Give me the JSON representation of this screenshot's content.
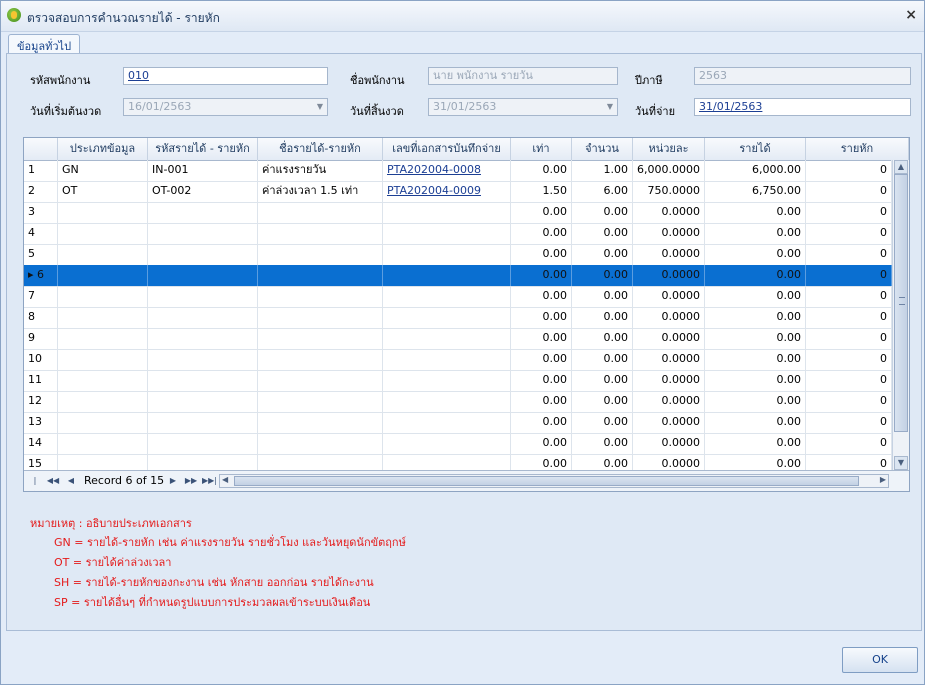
{
  "window": {
    "title": "ตรวจสอบการคำนวณรายได้ - รายหัก",
    "close_glyph": "×"
  },
  "tabs": [
    {
      "label": "ข้อมูลทั่วไป",
      "active": true
    }
  ],
  "form": {
    "employee_code_label": "รหัสพนักงาน",
    "employee_code": "010",
    "employee_name_label": "ชื่อพนักงาน",
    "employee_name": "นาย พนักงาน รายวัน",
    "tax_year_label": "ปีภาษี",
    "tax_year": "2563",
    "period_start_label": "วันที่เริ่มต้นงวด",
    "period_start": "16/01/2563",
    "period_end_label": "วันที่สิ้นงวด",
    "period_end": "31/01/2563",
    "pay_date_label": "วันที่จ่าย",
    "pay_date": "31/01/2563"
  },
  "grid": {
    "columns": [
      "",
      "ประเภทข้อมูล",
      "รหัสรายได้ - รายหัก",
      "ชื่อรายได้-รายหัก",
      "เลขที่เอกสารบันทึกจ่าย",
      "เท่า",
      "จำนวน",
      "หน่วยละ",
      "รายได้",
      "รายหัก"
    ],
    "rows": [
      {
        "no": "1",
        "type": "GN",
        "code": "IN-001",
        "name": "ค่าแรงรายวัน",
        "doc": "PTA202004-0008",
        "times": "0.00",
        "qty": "1.00",
        "unit": "6,000.0000",
        "income": "6,000.00",
        "deduct": "0"
      },
      {
        "no": "2",
        "type": "OT",
        "code": "OT-002",
        "name": "ค่าล่วงเวลา 1.5 เท่า",
        "doc": "PTA202004-0009",
        "times": "1.50",
        "qty": "6.00",
        "unit": "750.0000",
        "income": "6,750.00",
        "deduct": "0"
      },
      {
        "no": "3",
        "type": "",
        "code": "",
        "name": "",
        "doc": "",
        "times": "0.00",
        "qty": "0.00",
        "unit": "0.0000",
        "income": "0.00",
        "deduct": "0"
      },
      {
        "no": "4",
        "type": "",
        "code": "",
        "name": "",
        "doc": "",
        "times": "0.00",
        "qty": "0.00",
        "unit": "0.0000",
        "income": "0.00",
        "deduct": "0"
      },
      {
        "no": "5",
        "type": "",
        "code": "",
        "name": "",
        "doc": "",
        "times": "0.00",
        "qty": "0.00",
        "unit": "0.0000",
        "income": "0.00",
        "deduct": "0"
      },
      {
        "no": "6",
        "type": "",
        "code": "",
        "name": "",
        "doc": "",
        "times": "0.00",
        "qty": "0.00",
        "unit": "0.0000",
        "income": "0.00",
        "deduct": "0",
        "selected": true
      },
      {
        "no": "7",
        "type": "",
        "code": "",
        "name": "",
        "doc": "",
        "times": "0.00",
        "qty": "0.00",
        "unit": "0.0000",
        "income": "0.00",
        "deduct": "0"
      },
      {
        "no": "8",
        "type": "",
        "code": "",
        "name": "",
        "doc": "",
        "times": "0.00",
        "qty": "0.00",
        "unit": "0.0000",
        "income": "0.00",
        "deduct": "0"
      },
      {
        "no": "9",
        "type": "",
        "code": "",
        "name": "",
        "doc": "",
        "times": "0.00",
        "qty": "0.00",
        "unit": "0.0000",
        "income": "0.00",
        "deduct": "0"
      },
      {
        "no": "10",
        "type": "",
        "code": "",
        "name": "",
        "doc": "",
        "times": "0.00",
        "qty": "0.00",
        "unit": "0.0000",
        "income": "0.00",
        "deduct": "0"
      },
      {
        "no": "11",
        "type": "",
        "code": "",
        "name": "",
        "doc": "",
        "times": "0.00",
        "qty": "0.00",
        "unit": "0.0000",
        "income": "0.00",
        "deduct": "0"
      },
      {
        "no": "12",
        "type": "",
        "code": "",
        "name": "",
        "doc": "",
        "times": "0.00",
        "qty": "0.00",
        "unit": "0.0000",
        "income": "0.00",
        "deduct": "0"
      },
      {
        "no": "13",
        "type": "",
        "code": "",
        "name": "",
        "doc": "",
        "times": "0.00",
        "qty": "0.00",
        "unit": "0.0000",
        "income": "0.00",
        "deduct": "0"
      },
      {
        "no": "14",
        "type": "",
        "code": "",
        "name": "",
        "doc": "",
        "times": "0.00",
        "qty": "0.00",
        "unit": "0.0000",
        "income": "0.00",
        "deduct": "0"
      },
      {
        "no": "15",
        "type": "",
        "code": "",
        "name": "",
        "doc": "",
        "times": "0.00",
        "qty": "0.00",
        "unit": "0.0000",
        "income": "0.00",
        "deduct": "0"
      }
    ],
    "navigator": {
      "record_text": "Record 6 of 15"
    },
    "selected_marker": "▸"
  },
  "notes": {
    "title": "หมายเหตุ : อธิบายประเภทเอกสาร",
    "items": [
      "GN = รายได้-รายหัก เช่น ค่าแรงรายวัน รายชั่วโมง และวันหยุดนักขัตฤกษ์",
      "OT = รายได้ค่าล่วงเวลา",
      "SH = รายได้-รายหักของกะงาน เช่น หักสาย ออกก่อน รายได้กะงาน",
      "SP = รายได้อื่นๆ ที่กำหนดรูปแบบการประมวลผลเข้าระบบเงินเดือน"
    ]
  },
  "buttons": {
    "ok": "OK"
  },
  "colors": {
    "selected_row": "#0a6fd1",
    "note_text": "#e41a1a",
    "link": "#1c3f94"
  }
}
